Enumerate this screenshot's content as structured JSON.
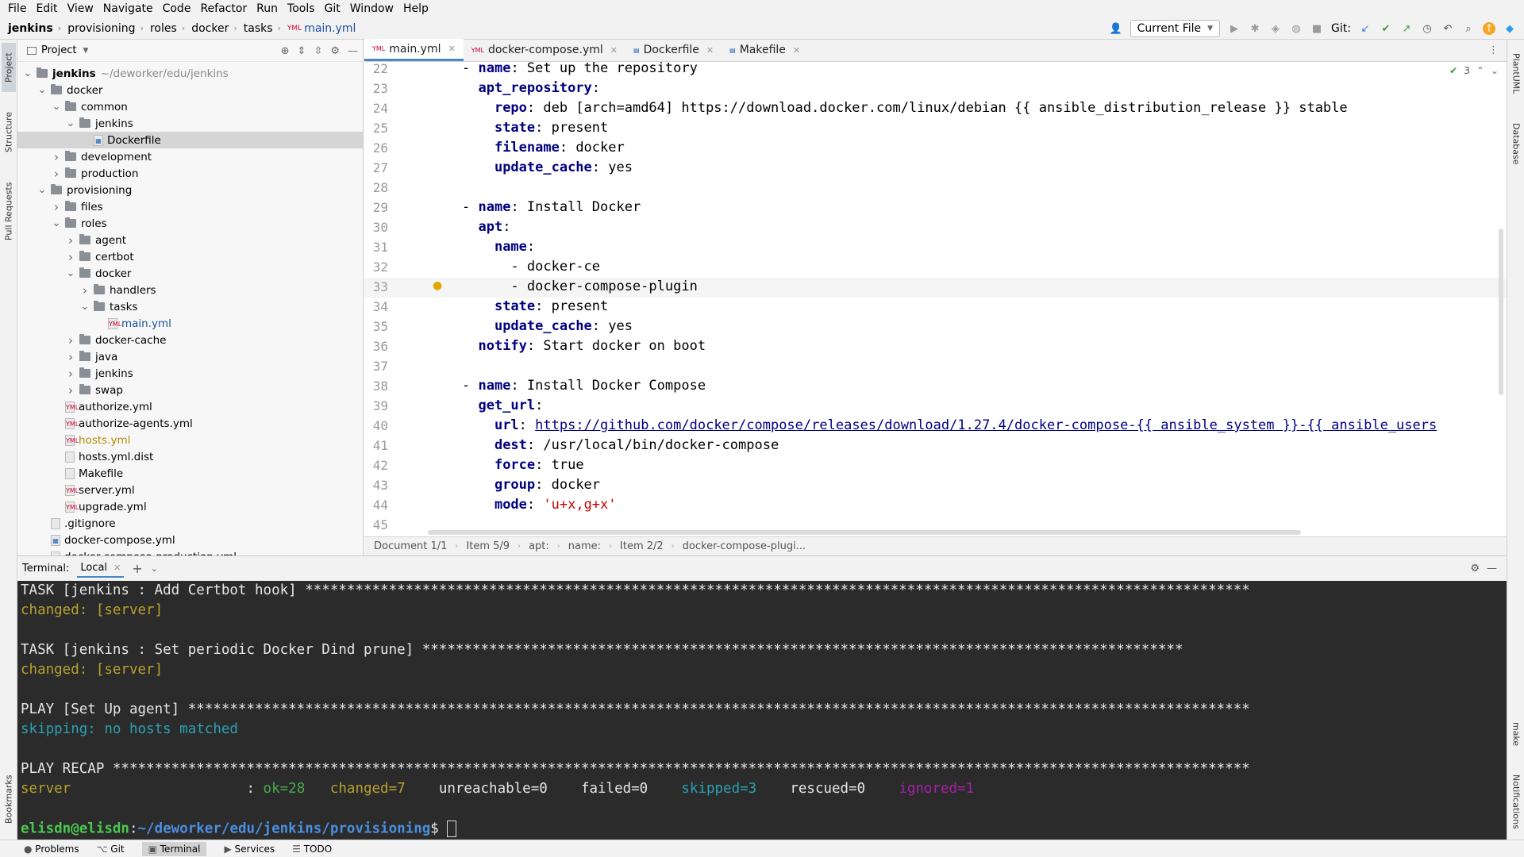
{
  "menu": [
    "File",
    "Edit",
    "View",
    "Navigate",
    "Code",
    "Refactor",
    "Run",
    "Tools",
    "Git",
    "Window",
    "Help"
  ],
  "breadcrumbs": [
    "jenkins",
    "provisioning",
    "roles",
    "docker",
    "tasks",
    "main.yml"
  ],
  "toolbar": {
    "run_config": "Current File",
    "git_label": "Git:"
  },
  "left_stripe": [
    "Project",
    "Structure",
    "Pull Requests",
    "Bookmarks"
  ],
  "right_stripe": [
    "PlantUML",
    "Database",
    "make",
    "Notifications"
  ],
  "project": {
    "title": "Project",
    "tree": [
      {
        "label": "jenkins",
        "extra": "~/deworker/edu/jenkins",
        "depth": 0,
        "kind": "folder",
        "open": true
      },
      {
        "label": "docker",
        "depth": 1,
        "kind": "folder",
        "open": true
      },
      {
        "label": "common",
        "depth": 2,
        "kind": "folder",
        "open": true
      },
      {
        "label": "jenkins",
        "depth": 3,
        "kind": "folder",
        "open": true
      },
      {
        "label": "Dockerfile",
        "depth": 4,
        "kind": "docker",
        "selected": true
      },
      {
        "label": "development",
        "depth": 2,
        "kind": "folder",
        "open": false
      },
      {
        "label": "production",
        "depth": 2,
        "kind": "folder",
        "open": false
      },
      {
        "label": "provisioning",
        "depth": 1,
        "kind": "folder",
        "open": true
      },
      {
        "label": "files",
        "depth": 2,
        "kind": "folder",
        "open": false
      },
      {
        "label": "roles",
        "depth": 2,
        "kind": "folder",
        "open": true
      },
      {
        "label": "agent",
        "depth": 3,
        "kind": "folder",
        "open": false
      },
      {
        "label": "certbot",
        "depth": 3,
        "kind": "folder",
        "open": false
      },
      {
        "label": "docker",
        "depth": 3,
        "kind": "folder",
        "open": true
      },
      {
        "label": "handlers",
        "depth": 4,
        "kind": "folder",
        "open": false
      },
      {
        "label": "tasks",
        "depth": 4,
        "kind": "folder",
        "open": true
      },
      {
        "label": "main.yml",
        "depth": 5,
        "kind": "yml",
        "color": "blue"
      },
      {
        "label": "docker-cache",
        "depth": 3,
        "kind": "folder",
        "open": false
      },
      {
        "label": "java",
        "depth": 3,
        "kind": "folder",
        "open": false
      },
      {
        "label": "jenkins",
        "depth": 3,
        "kind": "folder",
        "open": false
      },
      {
        "label": "swap",
        "depth": 3,
        "kind": "folder",
        "open": false
      },
      {
        "label": "authorize.yml",
        "depth": 2,
        "kind": "yml"
      },
      {
        "label": "authorize-agents.yml",
        "depth": 2,
        "kind": "yml"
      },
      {
        "label": "hosts.yml",
        "depth": 2,
        "kind": "yml",
        "color": "orange"
      },
      {
        "label": "hosts.yml.dist",
        "depth": 2,
        "kind": "file"
      },
      {
        "label": "Makefile",
        "depth": 2,
        "kind": "file"
      },
      {
        "label": "server.yml",
        "depth": 2,
        "kind": "yml"
      },
      {
        "label": "upgrade.yml",
        "depth": 2,
        "kind": "yml"
      },
      {
        "label": ".gitignore",
        "depth": 1,
        "kind": "file"
      },
      {
        "label": "docker-compose.yml",
        "depth": 1,
        "kind": "docker"
      },
      {
        "label": "docker-compose-production.yml",
        "depth": 1,
        "kind": "docker"
      }
    ]
  },
  "editor": {
    "tabs": [
      {
        "label": "main.yml",
        "active": true
      },
      {
        "label": "docker-compose.yml"
      },
      {
        "label": "Dockerfile"
      },
      {
        "label": "Makefile"
      }
    ],
    "inspection_count": "3",
    "lines": [
      {
        "n": "22",
        "html": "- <span class='k'>name</span>: Set up the repository"
      },
      {
        "n": "23",
        "html": "  <span class='k'>apt_repository</span>:"
      },
      {
        "n": "24",
        "html": "    <span class='k'>repo</span>: deb [arch=amd64] https://download.docker.com/linux/debian {{ ansible_distribution_release }} stable"
      },
      {
        "n": "25",
        "html": "    <span class='k'>state</span>: present"
      },
      {
        "n": "26",
        "html": "    <span class='k'>filename</span>: docker"
      },
      {
        "n": "27",
        "html": "    <span class='k'>update_cache</span>: yes"
      },
      {
        "n": "28",
        "html": ""
      },
      {
        "n": "29",
        "html": "- <span class='k'>name</span>: Install Docker"
      },
      {
        "n": "30",
        "html": "  <span class='k'>apt</span>:"
      },
      {
        "n": "31",
        "html": "    <span class='k'>name</span>:"
      },
      {
        "n": "32",
        "html": "      - docker-ce"
      },
      {
        "n": "33",
        "html": "      - docker-compose-plugin"
      },
      {
        "n": "34",
        "html": "    <span class='k'>state</span>: present"
      },
      {
        "n": "35",
        "html": "    <span class='k'>update_cache</span>: yes"
      },
      {
        "n": "36",
        "html": "  <span class='k'>notify</span>: Start docker on boot"
      },
      {
        "n": "37",
        "html": ""
      },
      {
        "n": "38",
        "html": "- <span class='k'>name</span>: Install Docker Compose"
      },
      {
        "n": "39",
        "html": "  <span class='k'>get_url</span>:"
      },
      {
        "n": "40",
        "html": "    <span class='k'>url</span>: <span class='u'>https://github.com/docker/compose/releases/download/1.27.4/docker-compose-{{ ansible_system }}-{{ ansible_users</span>"
      },
      {
        "n": "41",
        "html": "    <span class='k'>dest</span>: /usr/local/bin/docker-compose"
      },
      {
        "n": "42",
        "html": "    <span class='k'>force</span>: true"
      },
      {
        "n": "43",
        "html": "    <span class='k'>group</span>: docker"
      },
      {
        "n": "44",
        "html": "    <span class='k'>mode</span>: <span class='q'>'u+x,g+x'</span>"
      },
      {
        "n": "45",
        "html": ""
      }
    ],
    "current_line": "33"
  },
  "statusline": [
    "Document 1/1",
    "Item 5/9",
    "apt:",
    "name:",
    "Item 2/2",
    "docker-compose-plugi..."
  ],
  "terminal": {
    "title": "Terminal:",
    "tab": "Local",
    "lines": [
      {
        "html": "TASK [jenkins : Add Certbot hook] *****************************************************************************************************************"
      },
      {
        "html": "<span class='yellow'>changed: [server]</span>"
      },
      {
        "html": ""
      },
      {
        "html": "TASK [jenkins : Set periodic Docker Dind prune] *******************************************************************************************"
      },
      {
        "html": "<span class='yellow'>changed: [server]</span>"
      },
      {
        "html": ""
      },
      {
        "html": "PLAY [Set Up agent] *******************************************************************************************************************************"
      },
      {
        "html": "<span class='cyan'>skipping: no hosts matched</span>"
      },
      {
        "html": ""
      },
      {
        "html": "PLAY RECAP ****************************************************************************************************************************************"
      },
      {
        "html": "<span class='yellow'>server</span>                     : <span class='green'>ok=28</span>   <span class='yellow'>changed=7</span>    unreachable=0    failed=0    <span class='cyan'>skipped=3</span>    rescued=0    <span class='magenta'>ignored=1</span>"
      },
      {
        "html": ""
      },
      {
        "html": "<span class='gprompt'>elisdn@elisdn</span>:<span class='bprompt'>~/deworker/edu/jenkins/provisioning</span>$ <span class='cursor'></span>"
      }
    ]
  },
  "bottom_tools": [
    "Problems",
    "Git",
    "Terminal",
    "Services",
    "TODO"
  ]
}
